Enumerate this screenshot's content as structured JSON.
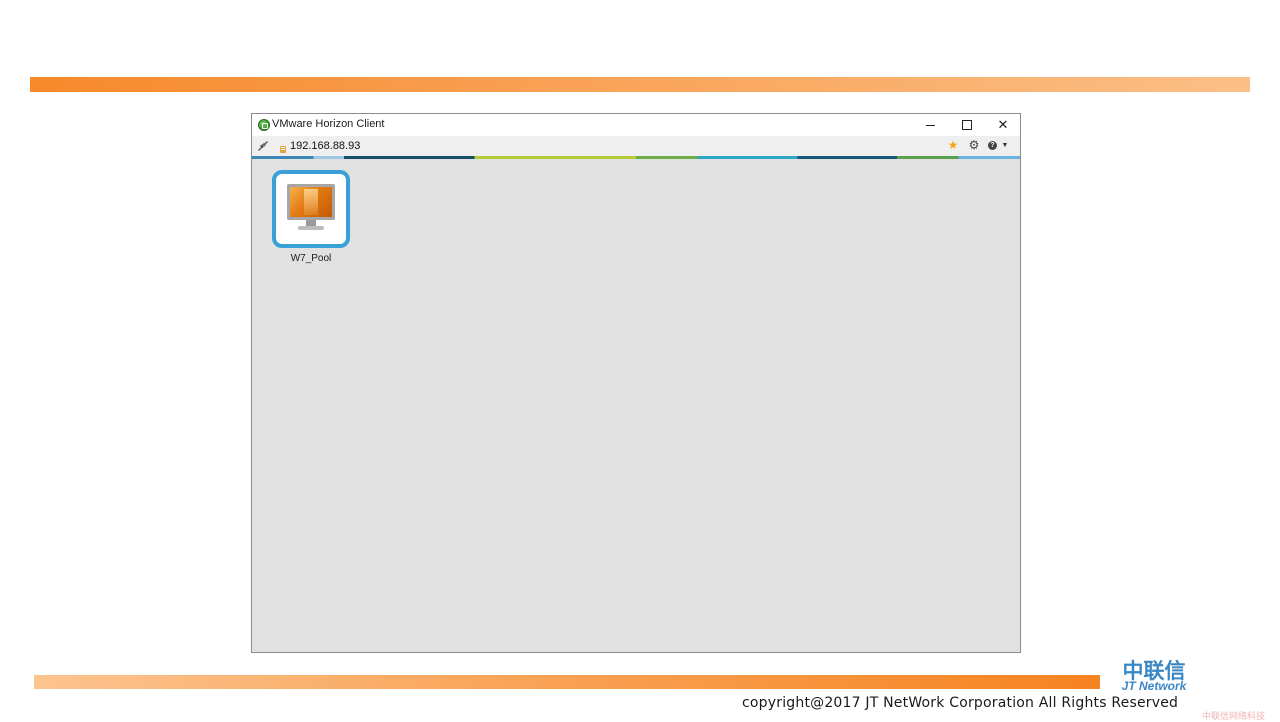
{
  "slide": {
    "brand_cn": "中联信",
    "brand_en": "JT Network",
    "copyright": "copyright@2017  JT NetWork Corporation All Rights Reserved",
    "watermark": "中联信网络科技",
    "colors": {
      "accent_orange": "#f7892b",
      "brand_blue": "#3a87c5"
    }
  },
  "window": {
    "title": "VMware Horizon Client",
    "app_icon": "vmware-horizon-icon",
    "controls": {
      "minimize_icon": "minimize-icon",
      "maximize_icon": "maximize-icon",
      "close_icon": "close-icon",
      "close_glyph": "✕"
    }
  },
  "toolbar": {
    "disconnect_icon": "disconnect-icon",
    "server_icon": "server-icon",
    "server_address": "192.168.88.93",
    "favorite_icon": "star-icon",
    "favorite_glyph": "★",
    "settings_icon": "gear-icon",
    "settings_glyph": "⚙",
    "help_icon": "help-icon",
    "help_glyph": "?",
    "dropdown_glyph": "▼"
  },
  "pools": [
    {
      "label": "W7_Pool",
      "icon": "desktop-monitor-icon",
      "selected": true
    }
  ]
}
